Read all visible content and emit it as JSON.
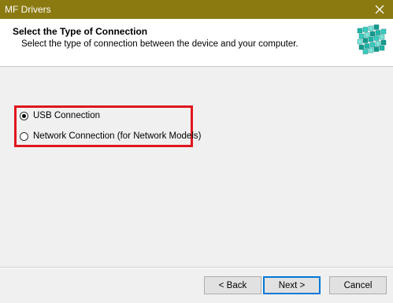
{
  "window": {
    "title": "MF Drivers",
    "close_icon": "close-icon",
    "titlebar_color": "#8b7a10"
  },
  "header": {
    "title": "Select the Type of Connection",
    "subtitle": "Select the type of connection between the device and your computer.",
    "logo_icon": "installer-cube-icon"
  },
  "connection_options": {
    "highlight_color": "#e0161e",
    "selected": "USB Connection",
    "items": [
      {
        "label": "USB Connection",
        "checked": true
      },
      {
        "label": "Network Connection (for Network Models)",
        "checked": false
      }
    ]
  },
  "footer": {
    "back_label": "< Back",
    "next_label": "Next >",
    "cancel_label": "Cancel"
  }
}
